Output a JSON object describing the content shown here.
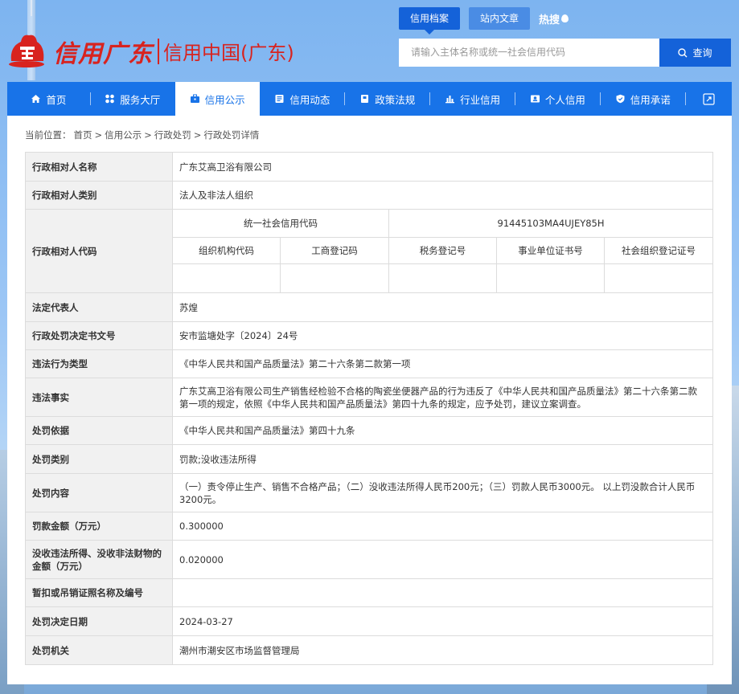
{
  "header": {
    "logo_script": "信用广东",
    "logo_text": "信用中国(广东)",
    "top_tabs": [
      "信用档案",
      "站内文章"
    ],
    "hot_label": "热搜",
    "search_placeholder": "请输入主体名称或统一社会信用代码",
    "search_button": "查询"
  },
  "nav": {
    "items": [
      {
        "label": "首页",
        "icon": "home-icon"
      },
      {
        "label": "服务大厅",
        "icon": "grid-icon"
      },
      {
        "label": "信用公示",
        "icon": "briefcase-icon",
        "active": true
      },
      {
        "label": "信用动态",
        "icon": "news-icon"
      },
      {
        "label": "政策法规",
        "icon": "book-icon"
      },
      {
        "label": "行业信用",
        "icon": "chart-icon"
      },
      {
        "label": "个人信用",
        "icon": "id-card-icon"
      },
      {
        "label": "信用承诺",
        "icon": "shield-icon"
      }
    ]
  },
  "breadcrumb": {
    "prefix": "当前位置：",
    "items": [
      "首页",
      "信用公示",
      "行政处罚",
      "行政处罚详情"
    ],
    "separator": ">"
  },
  "detail": {
    "name_label": "行政相对人名称",
    "name_value": "广东艾高卫浴有限公司",
    "category_label": "行政相对人类别",
    "category_value": "法人及非法人组织",
    "code_label": "行政相对人代码",
    "uscc_label": "统一社会信用代码",
    "uscc_value": "91445103MA4UJEY85H",
    "sub_headers": [
      "组织机构代码",
      "工商登记码",
      "税务登记号",
      "事业单位证书号",
      "社会组织登记证号"
    ],
    "sub_values": [
      "",
      "",
      "",
      "",
      ""
    ],
    "legal_rep_label": "法定代表人",
    "legal_rep_value": "苏煌",
    "doc_no_label": "行政处罚决定书文号",
    "doc_no_value": "安市监塘处字〔2024〕24号",
    "violation_type_label": "违法行为类型",
    "violation_type_value": "《中华人民共和国产品质量法》第二十六条第二款第一项",
    "facts_label": "违法事实",
    "facts_value": "广东艾高卫浴有限公司生产销售经检验不合格的陶瓷坐便器产品的行为违反了《中华人民共和国产品质量法》第二十六条第二款第一项的规定，依照《中华人民共和国产品质量法》第四十九条的规定，应予处罚，建议立案调查。",
    "basis_label": "处罚依据",
    "basis_value": "《中华人民共和国产品质量法》第四十九条",
    "penalty_type_label": "处罚类别",
    "penalty_type_value": "罚款;没收违法所得",
    "content_label": "处罚内容",
    "content_value": "（一）责令停止生产、销售不合格产品；（二）没收违法所得人民币200元；（三）罚款人民币3000元。 以上罚没款合计人民币3200元。",
    "fine_label": "罚款金额（万元）",
    "fine_value": "0.300000",
    "confiscate_label": "没收违法所得、没收非法财物的金额（万元）",
    "confiscate_value": "0.020000",
    "license_label": "暂扣或吊销证照名称及编号",
    "license_value": "",
    "date_label": "处罚决定日期",
    "date_value": "2024-03-27",
    "authority_label": "处罚机关",
    "authority_value": "潮州市潮安区市场监督管理局"
  },
  "colors": {
    "brand_red": "#d8231f",
    "nav_blue": "#1873e8",
    "button_blue": "#1462d9"
  }
}
